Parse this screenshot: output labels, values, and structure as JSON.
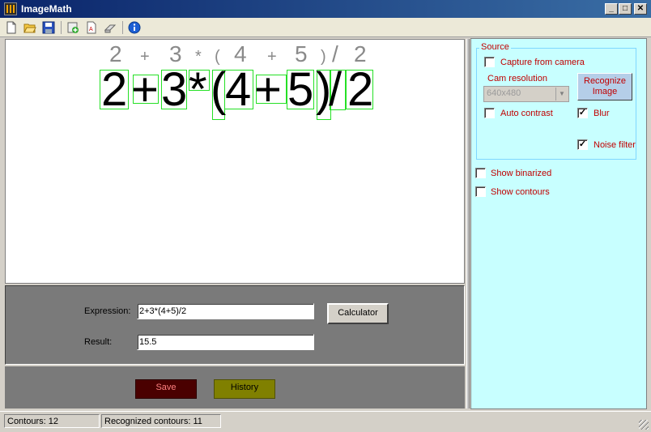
{
  "window": {
    "title": "ImageMath",
    "minimize_glyph": "_",
    "maximize_glyph": "□",
    "close_glyph": "✕"
  },
  "toolbar": {
    "icons": [
      "new-document-icon",
      "open-folder-icon",
      "save-disk-icon",
      "add-image-icon",
      "text-document-icon",
      "eraser-icon",
      "info-icon"
    ]
  },
  "canvas": {
    "guide_chars": [
      "2",
      "+",
      "3",
      "*",
      "(",
      "4",
      "+",
      "5",
      ")",
      "/",
      "2"
    ],
    "handwritten_chars": [
      "2",
      "+",
      "3",
      "*",
      "(",
      "4",
      "+",
      "5",
      ")",
      "/",
      "2"
    ],
    "bbox_color": "#25e025"
  },
  "expression_panel": {
    "expression_label": "Expression:",
    "expression_value": "2+3*(4+5)/2",
    "result_label": "Result:",
    "result_value": "15.5",
    "calculator_label": "Calculator"
  },
  "actions": {
    "save_label": "Save",
    "save_color": "#4a0000",
    "save_text_color": "#ff8080",
    "history_label": "History",
    "history_color": "#808000"
  },
  "side_panel": {
    "background": "#c8ffff",
    "source_legend": "Source",
    "capture_label": "Capture from camera",
    "capture_checked": false,
    "cam_resolution_label": "Cam resolution",
    "cam_resolution_value": "640x480",
    "recognize_label_line1": "Recognize",
    "recognize_label_line2": "Image",
    "auto_contrast_label": "Auto contrast",
    "auto_contrast_checked": false,
    "blur_label": "Blur",
    "blur_checked": true,
    "noise_filter_label": "Noise filter",
    "noise_filter_checked": true,
    "show_binarized_label": "Show binarized",
    "show_binarized_checked": false,
    "show_contours_label": "Show contours",
    "show_contours_checked": false
  },
  "status": {
    "contours": "Contours: 12",
    "recognized": "Recognized contours: 11"
  }
}
